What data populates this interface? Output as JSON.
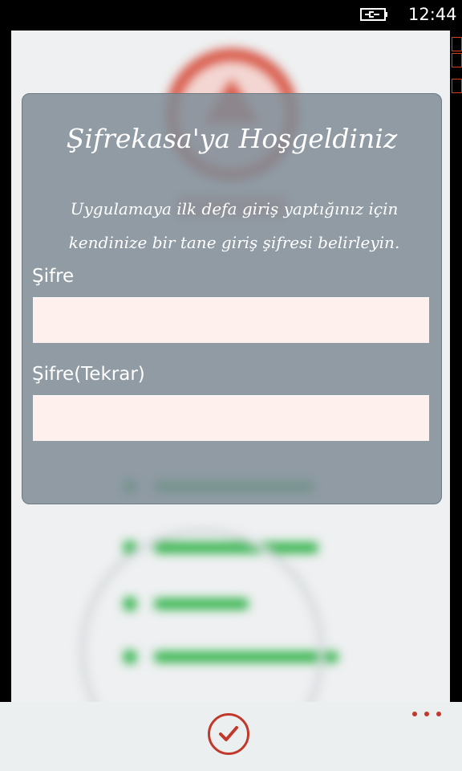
{
  "status_bar": {
    "time": "12:44",
    "battery_icon": "battery-charging-icon"
  },
  "dialog": {
    "title": "Şifrekasa'ya Hoşgeldiniz",
    "message": "Uygulamaya ilk defa giriş yaptığınız için kendinize bir tane giriş şifresi belirleyin.",
    "password_label": "Şifre",
    "password_value": "",
    "password_repeat_label": "Şifre(Tekrar)",
    "password_repeat_value": ""
  },
  "app_bar": {
    "ok_icon": "checkmark-icon",
    "more_icon": "ellipsis-icon"
  },
  "colors": {
    "accent": "#c0392b",
    "input_background": "#fdf0ed",
    "dialog_background": "#808d97",
    "background_green": "#2fb24a"
  }
}
